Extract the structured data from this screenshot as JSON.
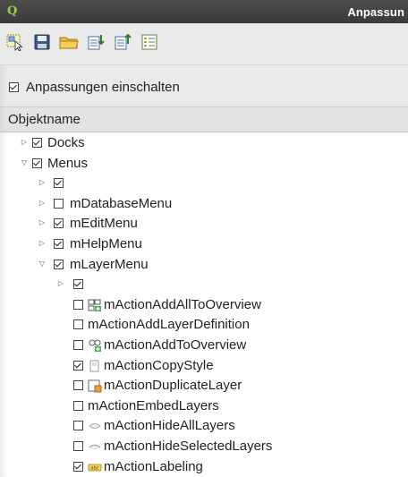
{
  "window": {
    "title": "Anpassun",
    "logo": "Q"
  },
  "toolbar": {
    "buttons": [
      {
        "icon": "select-icon"
      },
      {
        "icon": "save-icon"
      },
      {
        "icon": "open-folder-icon"
      },
      {
        "icon": "import-icon"
      },
      {
        "icon": "export-icon"
      },
      {
        "icon": "list-icon"
      }
    ]
  },
  "enable": {
    "label": "Anpassungen einschalten",
    "checked": true
  },
  "column_header": {
    "label": "Objektname"
  },
  "tree": [
    {
      "label": "Docks",
      "checked": true,
      "arrow": "right",
      "indent": 0,
      "icon": ""
    },
    {
      "label": "Menus",
      "checked": true,
      "arrow": "down",
      "indent": 0,
      "icon": ""
    },
    {
      "label": "",
      "checked": true,
      "arrow": "right",
      "indent": 1,
      "icon": ""
    },
    {
      "label": "mDatabaseMenu",
      "checked": false,
      "arrow": "right",
      "indent": 1,
      "icon": ""
    },
    {
      "label": "mEditMenu",
      "checked": true,
      "arrow": "right",
      "indent": 1,
      "icon": ""
    },
    {
      "label": "mHelpMenu",
      "checked": true,
      "arrow": "right",
      "indent": 1,
      "icon": ""
    },
    {
      "label": "mLayerMenu",
      "checked": true,
      "arrow": "down",
      "indent": 1,
      "icon": ""
    },
    {
      "label": "",
      "checked": true,
      "arrow": "right",
      "indent": 2,
      "icon": ""
    },
    {
      "label": "mActionAddAllToOverview",
      "checked": false,
      "arrow": "",
      "indent": 2,
      "icon": "overview-add-all-icon"
    },
    {
      "label": "mActionAddLayerDefinition",
      "checked": false,
      "arrow": "",
      "indent": 2,
      "icon": ""
    },
    {
      "label": "mActionAddToOverview",
      "checked": false,
      "arrow": "",
      "indent": 2,
      "icon": "overview-add-icon"
    },
    {
      "label": "mActionCopyStyle",
      "checked": true,
      "arrow": "",
      "indent": 2,
      "icon": "copy-style-icon"
    },
    {
      "label": "mActionDuplicateLayer",
      "checked": false,
      "arrow": "",
      "indent": 2,
      "icon": "duplicate-layer-icon"
    },
    {
      "label": "mActionEmbedLayers",
      "checked": false,
      "arrow": "",
      "indent": 2,
      "icon": ""
    },
    {
      "label": "mActionHideAllLayers",
      "checked": false,
      "arrow": "",
      "indent": 2,
      "icon": "hide-layers-icon"
    },
    {
      "label": "mActionHideSelectedLayers",
      "checked": false,
      "arrow": "",
      "indent": 2,
      "icon": "hide-selected-icon"
    },
    {
      "label": "mActionLabeling",
      "checked": true,
      "arrow": "",
      "indent": 2,
      "icon": "labeling-icon"
    }
  ]
}
